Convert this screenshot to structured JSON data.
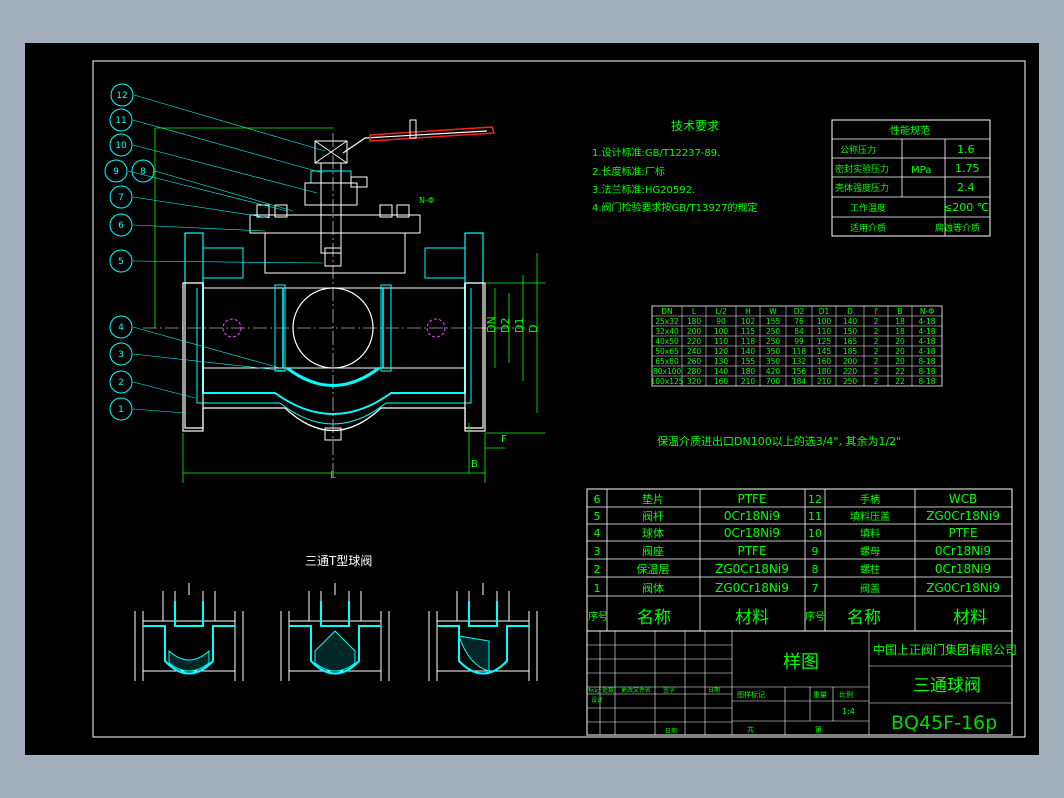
{
  "tech_req": {
    "title": "技术要求",
    "items": [
      "1.设计标准:GB/T12237-89.",
      "2.长度标准:厂标",
      "3.法兰标准:HG20592.",
      "4.阀门检验要求按GB/T13927的规定"
    ]
  },
  "perf": {
    "title": "性能规范",
    "unit": "MPa",
    "rows": [
      {
        "label": "公称压力",
        "value": "1.6"
      },
      {
        "label": "密封实验压力",
        "value": "1.75"
      },
      {
        "label": "壳体强度压力",
        "value": "2.4"
      },
      {
        "label": "工作温度",
        "value": "≤200 ℃"
      },
      {
        "label": "适用介质",
        "value": "腐蚀等介质"
      }
    ]
  },
  "dim_table": {
    "headers": [
      "DN",
      "L",
      "L/2",
      "H",
      "W",
      "D2",
      "D1",
      "D",
      "f",
      "B",
      "N-Φ"
    ],
    "rows": [
      [
        "25x32",
        "180",
        "90",
        "102",
        "155",
        "76",
        "100",
        "140",
        "2",
        "18",
        "4-18"
      ],
      [
        "32x40",
        "200",
        "100",
        "115",
        "250",
        "84",
        "110",
        "150",
        "2",
        "18",
        "4-18"
      ],
      [
        "40x50",
        "220",
        "110",
        "118",
        "250",
        "99",
        "125",
        "165",
        "2",
        "20",
        "4-18"
      ],
      [
        "50x65",
        "240",
        "120",
        "140",
        "350",
        "118",
        "145",
        "185",
        "2",
        "20",
        "4-18"
      ],
      [
        "65x80",
        "260",
        "130",
        "155",
        "350",
        "132",
        "160",
        "200",
        "2",
        "20",
        "8-18"
      ],
      [
        "80x100",
        "280",
        "140",
        "180",
        "420",
        "156",
        "180",
        "220",
        "2",
        "22",
        "8-18"
      ],
      [
        "100x125",
        "320",
        "160",
        "210",
        "700",
        "184",
        "210",
        "250",
        "2",
        "22",
        "8-18"
      ]
    ]
  },
  "note": "保温介质进出口DN100以上的选3/4\", 其余为1/2\"",
  "small_title": "三通T型球阀",
  "labels": {
    "balloons": [
      "12",
      "11",
      "10",
      "9",
      "8",
      "7",
      "6",
      "5",
      "4",
      "3",
      "2",
      "1"
    ],
    "dn": "DN",
    "d2": "D2",
    "d1": "D1",
    "d": "D",
    "f": "F",
    "b": "B",
    "l": "L",
    "nphi": "N-Φ"
  },
  "parts": {
    "rows": [
      {
        "no": "6",
        "name": "垫片",
        "material": "PTFE",
        "no2": "12",
        "name2": "手柄",
        "material2": "WCB"
      },
      {
        "no": "5",
        "name": "阀杆",
        "material": "0Cr18Ni9",
        "no2": "11",
        "name2": "填料压盖",
        "material2": "ZG0Cr18Ni9"
      },
      {
        "no": "4",
        "name": "球体",
        "material": "0Cr18Ni9",
        "no2": "10",
        "name2": "填料",
        "material2": "PTFE"
      },
      {
        "no": "3",
        "name": "阀座",
        "material": "PTFE",
        "no2": "9",
        "name2": "螺母",
        "material2": "0Cr18Ni9"
      },
      {
        "no": "2",
        "name": "保温层",
        "material": "ZG0Cr18Ni9",
        "no2": "8",
        "name2": "螺柱",
        "material2": "0Cr18Ni9"
      },
      {
        "no": "1",
        "name": "阀体",
        "material": "ZG0Cr18Ni9",
        "no2": "7",
        "name2": "阀盖",
        "material2": "ZG0Cr18Ni9"
      }
    ],
    "header": {
      "no": "序号",
      "name": "名称",
      "material": "材料"
    }
  },
  "title_block": {
    "sample": "样图",
    "company": "中国上正阀门集团有限公司",
    "product": "三通球阀",
    "model": "BQ45F-16p",
    "scale": "1:4",
    "rev_labels": [
      "标记",
      "处数",
      "更改文件名",
      "签字",
      "日期"
    ],
    "design": "设计",
    "stage": "图样标记",
    "weight": "重量",
    "ratio": "比例",
    "total": "共",
    "sheet": "第",
    "date": "日期"
  },
  "colors": {
    "background": "#a3afbd",
    "sheet": "#000000",
    "lines": "#00ff00",
    "hatch": "#00ffff",
    "frame": "#ffffff",
    "handle": "#ff2020"
  }
}
